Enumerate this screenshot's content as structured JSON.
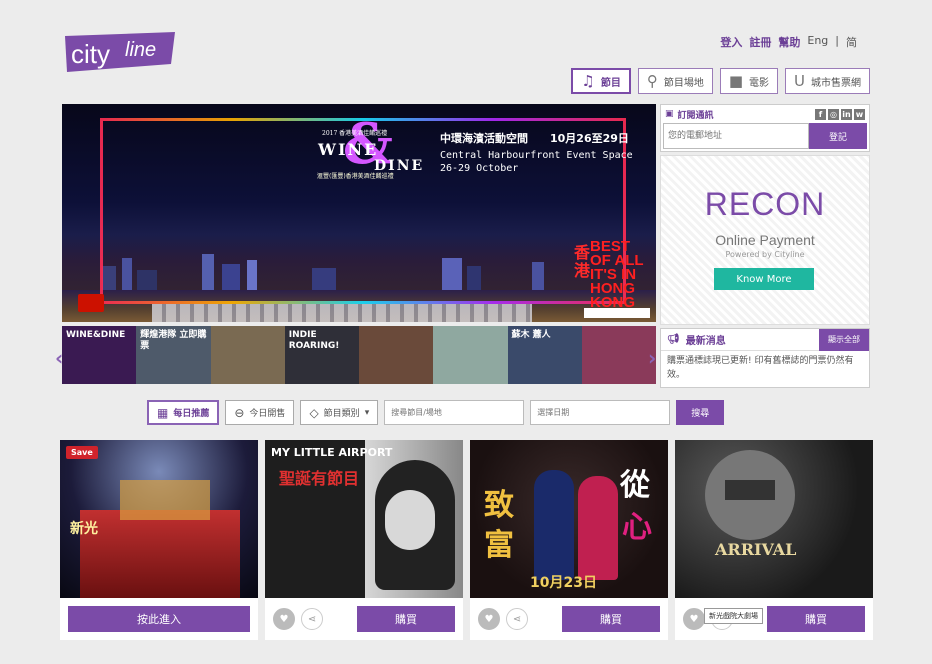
{
  "brand": {
    "logo_text_a": "city",
    "logo_text_b": "line"
  },
  "toplinks": [
    "登入",
    "註冊",
    "幫助",
    "Eng",
    "|",
    "简"
  ],
  "nav": [
    {
      "label": "節目",
      "icon": "music-note-icon",
      "active": true
    },
    {
      "label": "節目場地",
      "icon": "map-pin-icon",
      "active": false
    },
    {
      "label": "電影",
      "icon": "movie-camera-icon",
      "active": false
    },
    {
      "label": "城市售票網",
      "icon": "urbtix-icon",
      "active": false
    }
  ],
  "hero": {
    "wine": "WINE",
    "dine": "DINE",
    "small": "2017 香港美酒佳餚巡禮",
    "sub": "滙豐(匯豐)香港美酒佳餚巡禮",
    "venue_zh": "中環海濱活動空間",
    "date_zh": "10月26至29日",
    "venue_en": "Central Harbourfront Event Space",
    "date_en": "26-29 October",
    "best": [
      "BEST",
      "OF ALL",
      "IT'S IN",
      "HONG",
      "KONG"
    ],
    "hk_zh": "香港"
  },
  "thumbs": [
    {
      "text": "WINE&DINE",
      "color": "#3a1a52"
    },
    {
      "text": "輝煌港隊 立即購票",
      "color": "#4e5a6a"
    },
    {
      "text": "",
      "color": "#7a6a52"
    },
    {
      "text": "INDIE ROARING!",
      "color": "#2f2f38"
    },
    {
      "text": "",
      "color": "#6a4a3a"
    },
    {
      "text": "",
      "color": "#8fa8a0"
    },
    {
      "text": "蘇木 蕭人",
      "color": "#3a4a6a"
    },
    {
      "text": "",
      "color": "#8a3a5a"
    }
  ],
  "subscribe": {
    "title": "訂閱通訊",
    "placeholder": "您的電郵地址",
    "button": "登記",
    "social": [
      "f",
      "◎",
      "in",
      "w"
    ]
  },
  "ad": {
    "title": "RECON",
    "subtitle": "Online Payment",
    "powered": "Powered by Cityline",
    "button": "Know More"
  },
  "news": {
    "title": "最新消息",
    "all": "顯示全部",
    "body": "購票通標誌現已更新! 印有舊標誌的門票仍然有效。"
  },
  "search": {
    "daily": "每日推薦",
    "today": "今日開售",
    "category": "節目類別",
    "keyword_placeholder": "搜尋節目/場地",
    "date_placeholder": "選擇日期",
    "go": "搜尋"
  },
  "cards": [
    {
      "button": "按此進入",
      "save": "Save",
      "sign": "新光"
    },
    {
      "button": "購買",
      "title": "MY LITTLE AIRPORT",
      "sub": "聖誕有節目"
    },
    {
      "button": "購買",
      "c1": "致",
      "c2": "富",
      "c3": "從",
      "c4": "心",
      "date": "10月23日"
    },
    {
      "button": "購買",
      "title": "ARRIVAL",
      "tooltip": "新光戲院大劇場"
    }
  ]
}
